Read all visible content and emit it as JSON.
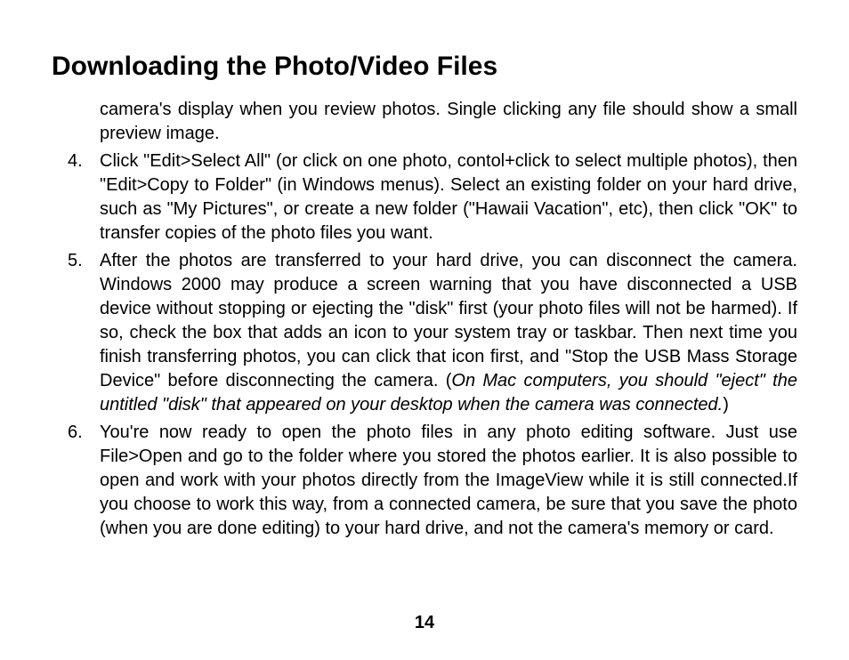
{
  "title": "Downloading the Photo/Video Files",
  "continuation": "camera's display when you review photos. Single clicking any file should show a small preview image.",
  "items": [
    {
      "number": "4.",
      "before": "Click \"Edit>Select All\" (or click on one photo, contol+click to select multiple photos), then \"Edit>Copy to Folder\" (in Windows menus). Select an existing folder on your hard drive, such as \"My Pictures\", or create a new folder (\"Hawaii Vacation\", etc), then click \"OK\" to transfer copies of the photo files you want.",
      "italic": "",
      "after": ""
    },
    {
      "number": "5.",
      "before": "After the photos are transferred to your hard drive, you can disconnect the camera. Windows 2000 may produce a screen warning that you have disconnected a USB device without stopping or ejecting the \"disk\" first (your photo files will not be harmed). If so, check the box that adds an icon to your system tray or taskbar.  Then next time you finish transferring photos, you can click that icon first, and \"Stop the USB Mass Storage Device\" before disconnecting the camera. (",
      "italic": "On Mac computers, you should \"eject\" the untitled \"disk\" that appeared on your desktop when the camera was connected.",
      "after": ")"
    },
    {
      "number": "6.",
      "before": "You're now ready to open the photo files in any photo editing software. Just use File>Open and go to the folder where you stored the photos earlier. It is also possible to open and work with your photos directly from the ImageView while it is still connected.If you choose to work this way, from a connected camera, be sure that you save the photo (when you are done editing) to your hard drive, and not the camera's memory or card.",
      "italic": "",
      "after": ""
    }
  ],
  "page_number": "14"
}
